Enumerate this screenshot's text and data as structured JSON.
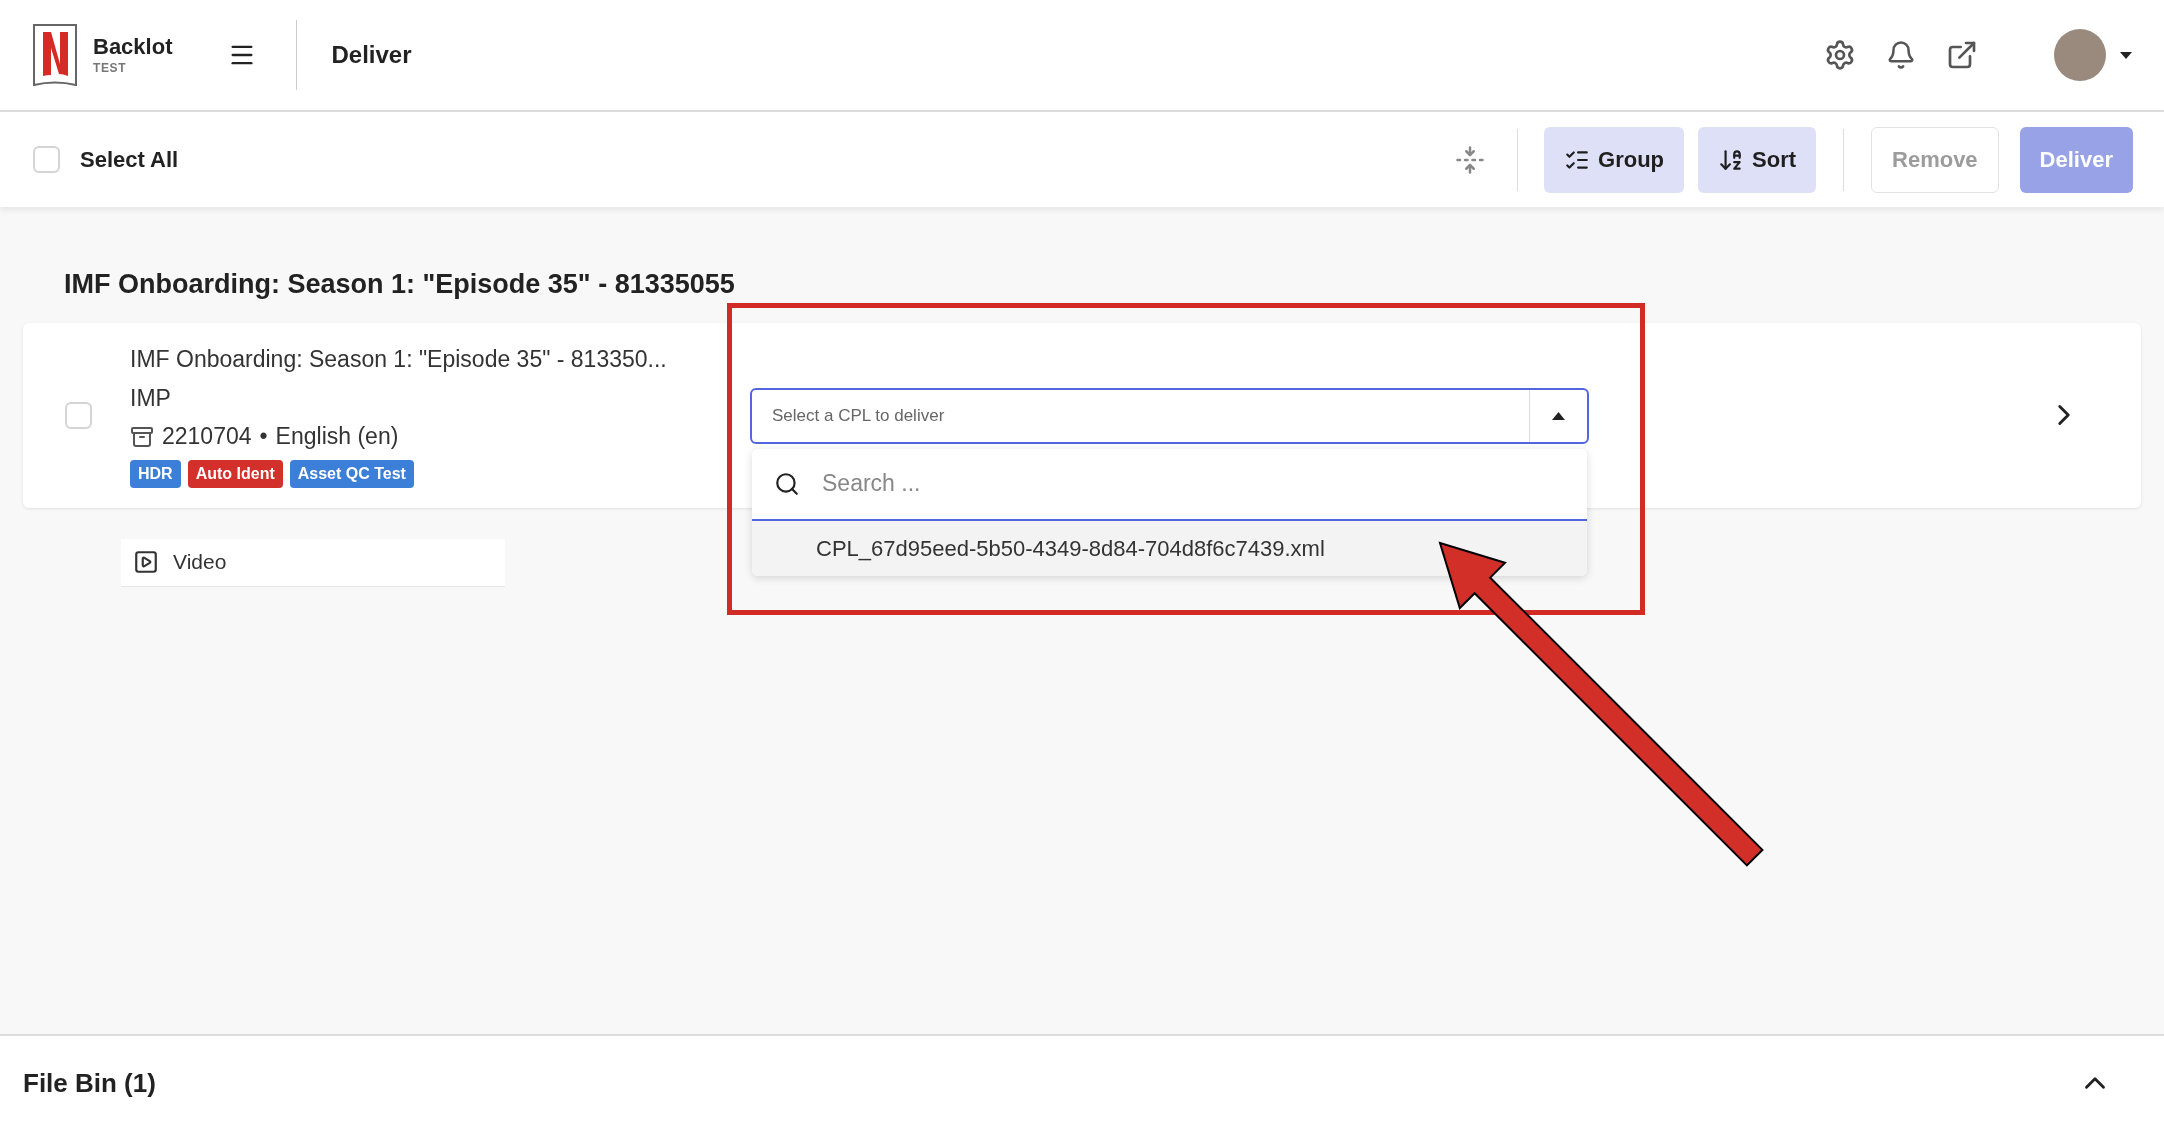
{
  "header": {
    "brand": "Backlot",
    "environment": "TEST",
    "page_title": "Deliver"
  },
  "toolbar": {
    "select_all": {
      "label": "Select All",
      "checked": false
    },
    "buttons": [
      {
        "label": "Group",
        "kind": "group",
        "disabled": false
      },
      {
        "label": "Sort",
        "kind": "sort",
        "disabled": false
      },
      {
        "label": "Remove",
        "kind": "outline",
        "disabled": true
      },
      {
        "label": "Deliver",
        "kind": "primary",
        "disabled": true
      }
    ]
  },
  "group": {
    "title": "IMF Onboarding: Season 1: \"Episode 35\" - 81335055",
    "items": [
      {
        "title": "IMF Onboarding: Season 1: \"Episode 35\" - 813350...",
        "type": "IMP",
        "id": "2210704",
        "separator": "•",
        "language": "English (en)",
        "checked": false,
        "tags": [
          {
            "label": "HDR",
            "color": "#3b7fd9"
          },
          {
            "label": "Auto Ident",
            "color": "#d3302b"
          },
          {
            "label": "Asset QC Test",
            "color": "#3b7fd9"
          }
        ],
        "cpl_select": {
          "placeholder": "Select a CPL to deliver",
          "expanded": true,
          "search_placeholder": "Search ...",
          "options": [
            "CPL_67d95eed-5b50-4349-8d84-704d8f6c7439.xml"
          ]
        }
      }
    ],
    "tracks": [
      {
        "label": "Video"
      }
    ]
  },
  "file_bin": {
    "title": "File Bin (1)"
  }
}
